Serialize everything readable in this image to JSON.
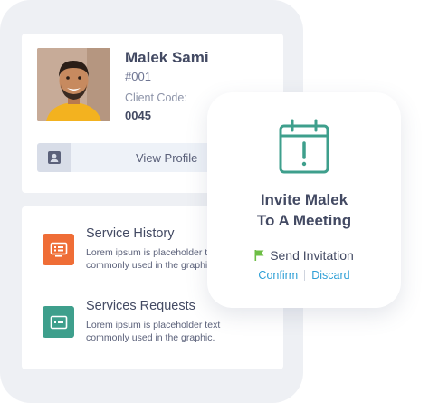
{
  "client": {
    "name": "Malek Sami",
    "id": "#001",
    "code_label": "Client Code:",
    "code_value": "0045",
    "view_profile_label": "View Profile"
  },
  "services": [
    {
      "title": "Service History",
      "description": "Lorem ipsum is placeholder text commonly used in the graphic.",
      "icon": "service-history-icon",
      "color": "#ef6d36"
    },
    {
      "title": "Services Requests",
      "description": "Lorem ipsum is placeholder text commonly used in the graphic.",
      "icon": "service-request-icon",
      "color": "#3e9f8c"
    }
  ],
  "invite": {
    "title_line1": "Invite Malek",
    "title_line2": "To A Meeting",
    "send_label": "Send Invitation",
    "confirm_label": "Confirm",
    "discard_label": "Discard",
    "icon": "calendar-alert-icon",
    "accent_color": "#3e9f8c",
    "link_color": "#2d9fd6",
    "flag_color": "#6dbe45"
  }
}
